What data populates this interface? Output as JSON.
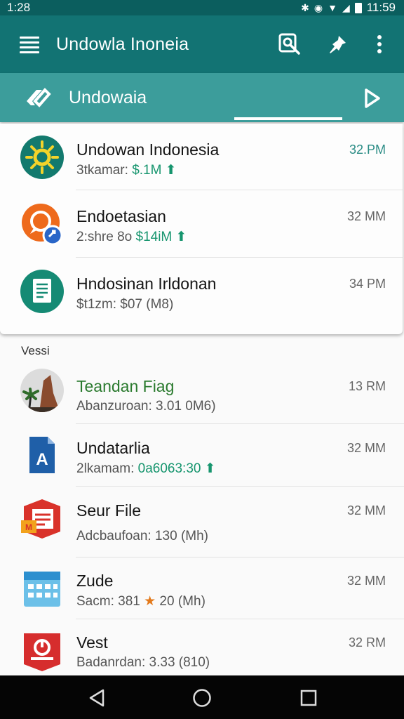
{
  "status_bar": {
    "time": "1:28",
    "clock": "11:59"
  },
  "app_bar": {
    "title": "Undowla Inoneia"
  },
  "tab": {
    "label": "Undowaia"
  },
  "pinned": [
    {
      "title": "Undowan Indonesia",
      "subtitle_a": "3tkamar: ",
      "subtitle_b": "$.1M",
      "time": "32.PM"
    },
    {
      "title": "Endoetasian",
      "subtitle_a": "2:shre 8o ",
      "subtitle_b": "$14iM",
      "time": "32 MM"
    },
    {
      "title": "Hndosinan Irldonan",
      "subtitle_a": "$t1zm: $07 (M8)",
      "time": "34 PM"
    }
  ],
  "section_label": "Vessi",
  "list": [
    {
      "title": "Teandan Fiag",
      "subtitle_a": "Abanzuroan: 3.01 0M6)",
      "time": "13 RM"
    },
    {
      "title": "Undatarlia",
      "subtitle_a": "2lkamam: ",
      "subtitle_b": "0a6063:30",
      "time": "32 MM"
    },
    {
      "title": "Seur File",
      "subtitle_a": "Adcbaufoan: 130 (Mh)",
      "time": "32 MM"
    },
    {
      "title": "Zude",
      "subtitle_a": "Sacm: 381 ",
      "subtitle_star": "★",
      "subtitle_c": " 20 (Mh)",
      "time": "32 MM"
    },
    {
      "title": "Vest",
      "subtitle_a": "Badanrdan: 3.33 (810)",
      "time": "32 RM"
    }
  ],
  "icons": {
    "menu": "menu-icon",
    "search": "search-icon",
    "pin": "pin-icon",
    "more": "more-vert-icon",
    "tab": "tag-icon",
    "play": "play-icon",
    "back": "back-icon",
    "home": "home-icon",
    "recents": "recents-icon"
  },
  "colors": {
    "app_bar": "#127373",
    "tab_bar": "#3c9d9b",
    "accent_green": "#16956e",
    "status_bar": "#0b5e5e"
  }
}
